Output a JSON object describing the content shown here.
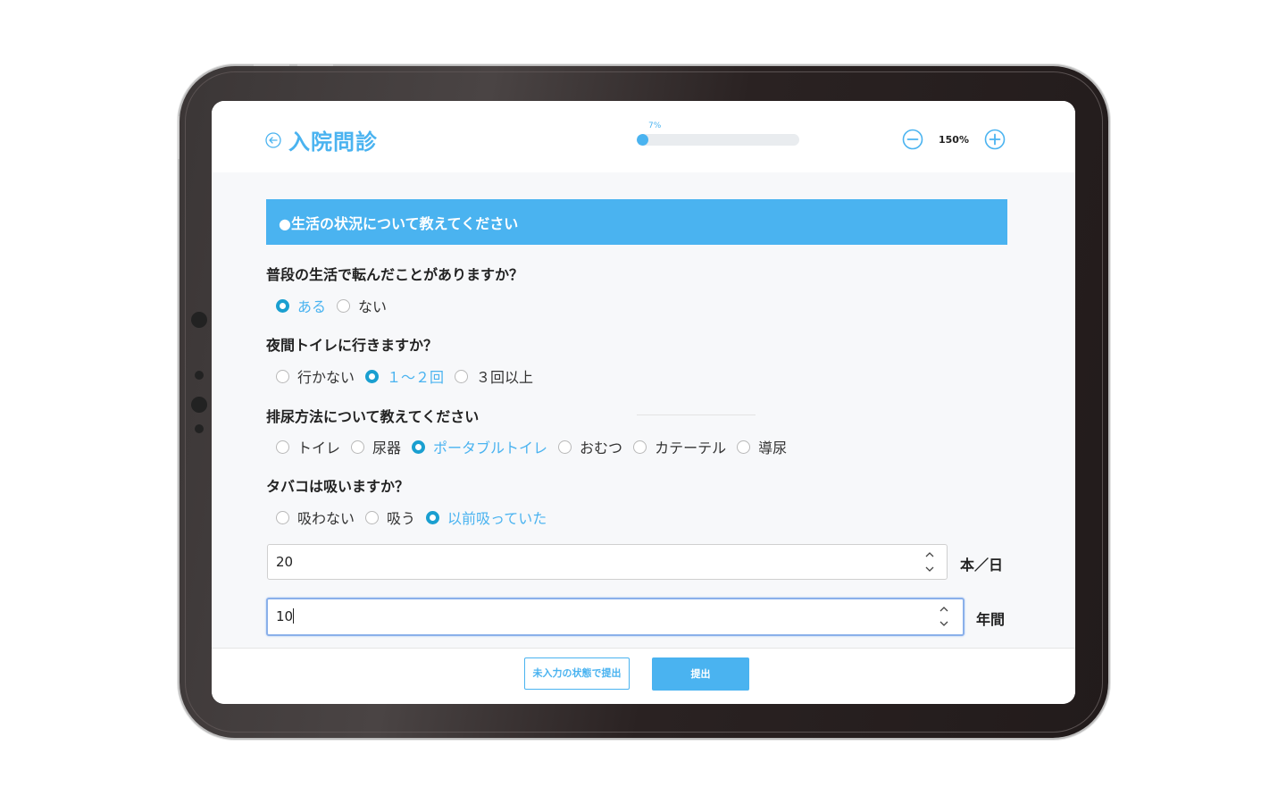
{
  "header": {
    "title": "入院問診",
    "progress_label": "7%",
    "progress_value": 0.07,
    "zoom_level": "150%"
  },
  "section": {
    "title": "●生活の状況について教えてください"
  },
  "questions": [
    {
      "label": "普段の生活で転んだことがありますか？",
      "options": [
        "ある",
        "ない"
      ],
      "selected": "ある"
    },
    {
      "label": "夜間トイレに行きますか？",
      "options": [
        "行かない",
        "１～２回",
        "３回以上"
      ],
      "selected": "１～２回"
    },
    {
      "label": "排尿方法について教えてください",
      "options": [
        "トイレ",
        "尿器",
        "ポータブルトイレ",
        "おむつ",
        "カテーテル",
        "導尿"
      ],
      "selected": "ポータブルトイレ"
    },
    {
      "label": "タバコは吸いますか？",
      "options": [
        "吸わない",
        "吸う",
        "以前吸っていた"
      ],
      "selected": "以前吸っていた"
    }
  ],
  "smoking": {
    "per_day_value": "20",
    "per_day_unit": "本／日",
    "years_value": "10",
    "years_unit": "年間"
  },
  "footer": {
    "submit_incomplete_label": "未入力の状態で提出",
    "submit_label": "提出"
  },
  "colors": {
    "accent": "#4ab3f0",
    "radio_checked": "#1a9fd0"
  }
}
